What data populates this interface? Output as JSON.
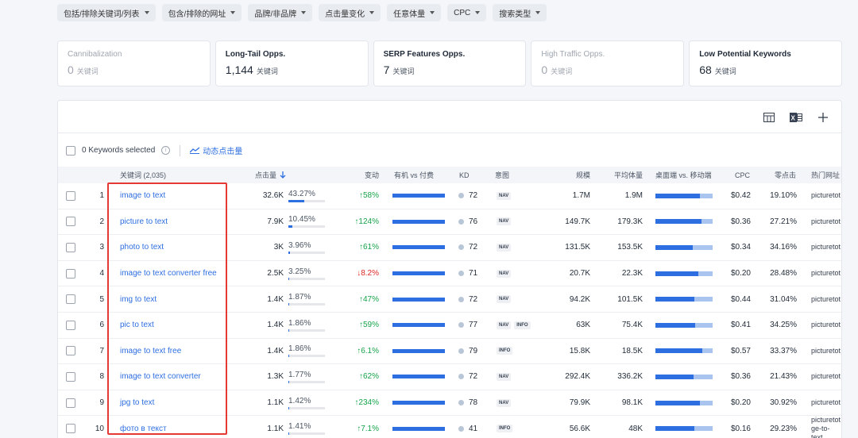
{
  "filters": [
    "包括/排除关键词/列表",
    "包含/排除的网址",
    "品牌/非品牌",
    "点击量变化",
    "任意体量",
    "CPC",
    "搜索类型"
  ],
  "cards": [
    {
      "title": "Cannibalization",
      "value": "0",
      "unit": "关键词",
      "muted": true
    },
    {
      "title": "Long-Tail Opps.",
      "value": "1,144",
      "unit": "关键词",
      "muted": false
    },
    {
      "title": "SERP Features Opps.",
      "value": "7",
      "unit": "关键词",
      "muted": false
    },
    {
      "title": "High Traffic Opps.",
      "value": "0",
      "unit": "关键词",
      "muted": true
    },
    {
      "title": "Low Potential Keywords",
      "value": "68",
      "unit": "关键词",
      "muted": false
    }
  ],
  "toolbar": {
    "icons": [
      "columns-icon",
      "excel-icon",
      "plus-icon"
    ]
  },
  "selection": {
    "label": "0 Keywords selected",
    "dynamic_label": "动态点击量"
  },
  "columns": {
    "keyword": "关键词 (2,035)",
    "clicks": "点击量",
    "change": "变动",
    "organic_vs_paid": "有机 vs 付费",
    "kd": "KD",
    "intent": "意图",
    "volume": "规模",
    "avg_volume": "平均体量",
    "desktop_vs_mobile": "桌面端 vs. 移动端",
    "cpc": "CPC",
    "zero_click": "零点击",
    "top_url": "热门网址"
  },
  "rows": [
    {
      "idx": "1",
      "keyword": "image to text",
      "clicks": "32.6K",
      "share": "43.27%",
      "share_frac": 0.43,
      "change": "58%",
      "dir": "up",
      "kd": "72",
      "intents": [
        "NAV"
      ],
      "volume": "1.7M",
      "avg": "1.9M",
      "desktop": 0.78,
      "cpc": "$0.42",
      "zero": "19.10%",
      "url": "picturetot"
    },
    {
      "idx": "2",
      "keyword": "picture to text",
      "clicks": "7.9K",
      "share": "10.45%",
      "share_frac": 0.1,
      "change": "124%",
      "dir": "up",
      "kd": "76",
      "intents": [
        "NAV"
      ],
      "volume": "149.7K",
      "avg": "179.3K",
      "desktop": 0.8,
      "cpc": "$0.36",
      "zero": "27.21%",
      "url": "picturetot"
    },
    {
      "idx": "3",
      "keyword": "photo to text",
      "clicks": "3K",
      "share": "3.96%",
      "share_frac": 0.04,
      "change": "61%",
      "dir": "up",
      "kd": "72",
      "intents": [
        "NAV"
      ],
      "volume": "131.5K",
      "avg": "153.5K",
      "desktop": 0.65,
      "cpc": "$0.34",
      "zero": "34.16%",
      "url": "picturetot"
    },
    {
      "idx": "4",
      "keyword": "image to text converter free",
      "clicks": "2.5K",
      "share": "3.25%",
      "share_frac": 0.03,
      "change": "8.2%",
      "dir": "down",
      "kd": "71",
      "intents": [
        "NAV"
      ],
      "volume": "20.7K",
      "avg": "22.3K",
      "desktop": 0.75,
      "cpc": "$0.20",
      "zero": "28.48%",
      "url": "picturetot"
    },
    {
      "idx": "5",
      "keyword": "img to text",
      "clicks": "1.4K",
      "share": "1.87%",
      "share_frac": 0.02,
      "change": "47%",
      "dir": "up",
      "kd": "72",
      "intents": [
        "NAV"
      ],
      "volume": "94.2K",
      "avg": "101.5K",
      "desktop": 0.68,
      "cpc": "$0.44",
      "zero": "31.04%",
      "url": "picturetot"
    },
    {
      "idx": "6",
      "keyword": "pic to text",
      "clicks": "1.4K",
      "share": "1.86%",
      "share_frac": 0.02,
      "change": "59%",
      "dir": "up",
      "kd": "77",
      "intents": [
        "NAV",
        "INFO"
      ],
      "volume": "63K",
      "avg": "75.4K",
      "desktop": 0.7,
      "cpc": "$0.41",
      "zero": "34.25%",
      "url": "picturetot"
    },
    {
      "idx": "7",
      "keyword": "image to text free",
      "clicks": "1.4K",
      "share": "1.86%",
      "share_frac": 0.02,
      "change": "6.1%",
      "dir": "up",
      "kd": "79",
      "intents": [
        "INFO"
      ],
      "volume": "15.8K",
      "avg": "18.5K",
      "desktop": 0.82,
      "cpc": "$0.57",
      "zero": "33.37%",
      "url": "picturetot"
    },
    {
      "idx": "8",
      "keyword": "image to text converter",
      "clicks": "1.3K",
      "share": "1.77%",
      "share_frac": 0.02,
      "change": "62%",
      "dir": "up",
      "kd": "72",
      "intents": [
        "NAV"
      ],
      "volume": "292.4K",
      "avg": "336.2K",
      "desktop": 0.66,
      "cpc": "$0.36",
      "zero": "21.43%",
      "url": "picturetot"
    },
    {
      "idx": "9",
      "keyword": "jpg to text",
      "clicks": "1.1K",
      "share": "1.42%",
      "share_frac": 0.01,
      "change": "234%",
      "dir": "up",
      "kd": "78",
      "intents": [
        "NAV"
      ],
      "volume": "79.9K",
      "avg": "98.1K",
      "desktop": 0.78,
      "cpc": "$0.20",
      "zero": "30.92%",
      "url": "picturetot"
    },
    {
      "idx": "10",
      "keyword": "фото в текст",
      "clicks": "1.1K",
      "share": "1.41%",
      "share_frac": 0.01,
      "change": "7.1%",
      "dir": "up",
      "kd": "41",
      "intents": [
        "INFO"
      ],
      "volume": "56.6K",
      "avg": "48K",
      "desktop": 0.68,
      "cpc": "$0.16",
      "zero": "29.23%",
      "url": "picturetot ge-to-text"
    }
  ],
  "colors": {
    "accent": "#2d6ee0",
    "up": "#16a34a",
    "down": "#dc2626",
    "highlight": "#e53935"
  }
}
